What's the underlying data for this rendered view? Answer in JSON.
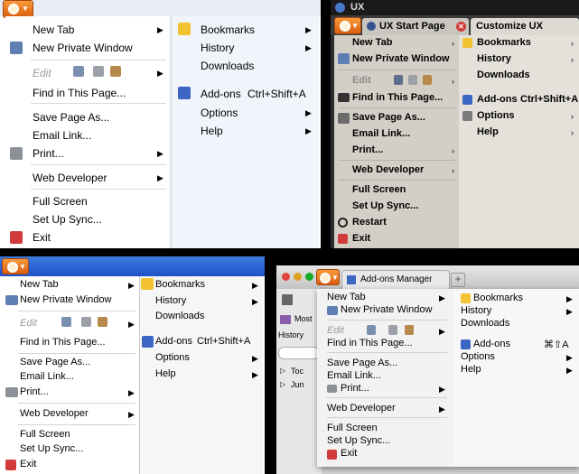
{
  "win7": {
    "left": [
      {
        "label": "New Tab",
        "arrow": true
      },
      {
        "label": "New Private Window",
        "icon": "private-window-icon"
      },
      {
        "label": "Edit",
        "arrow": true,
        "disabled": true
      },
      {
        "label": "Find in This Page..."
      },
      {
        "label": "Save Page As..."
      },
      {
        "label": "Email Link..."
      },
      {
        "label": "Print...",
        "arrow": true,
        "icon": "printer-icon"
      },
      {
        "label": "Web Developer",
        "arrow": true
      },
      {
        "label": "Full Screen"
      },
      {
        "label": "Set Up Sync..."
      },
      {
        "label": "Exit",
        "icon": "exit-icon"
      }
    ],
    "right": [
      {
        "label": "Bookmarks",
        "arrow": true,
        "icon": "star-icon"
      },
      {
        "label": "History",
        "arrow": true
      },
      {
        "label": "Downloads"
      },
      {
        "label": "Add-ons",
        "shortcut": "Ctrl+Shift+A",
        "icon": "puzzle-icon"
      },
      {
        "label": "Options",
        "arrow": true
      },
      {
        "label": "Help",
        "arrow": true
      }
    ]
  },
  "linux": {
    "window_title": "UX",
    "tabs": [
      "UX Start Page",
      "Customize UX"
    ],
    "left": [
      {
        "label": "New Tab"
      },
      {
        "label": "New Private Window"
      },
      {
        "label": "Edit"
      },
      {
        "label": "Find in This Page..."
      },
      {
        "label": "Save Page As..."
      },
      {
        "label": "Email Link..."
      },
      {
        "label": "Print..."
      },
      {
        "label": "Web Developer"
      },
      {
        "label": "Full Screen"
      },
      {
        "label": "Set Up Sync..."
      },
      {
        "label": "Restart"
      },
      {
        "label": "Exit"
      }
    ],
    "right": [
      {
        "label": "Bookmarks"
      },
      {
        "label": "History"
      },
      {
        "label": "Downloads"
      },
      {
        "label": "Add-ons",
        "shortcut": "Ctrl+Shift+A"
      },
      {
        "label": "Options"
      },
      {
        "label": "Help"
      }
    ]
  },
  "winxp": {
    "left": [
      {
        "label": "New Tab"
      },
      {
        "label": "New Private Window"
      },
      {
        "label": "Edit"
      },
      {
        "label": "Find in This Page..."
      },
      {
        "label": "Save Page As..."
      },
      {
        "label": "Email Link..."
      },
      {
        "label": "Print..."
      },
      {
        "label": "Web Developer"
      },
      {
        "label": "Full Screen"
      },
      {
        "label": "Set Up Sync..."
      },
      {
        "label": "Exit"
      }
    ],
    "right": [
      {
        "label": "Bookmarks"
      },
      {
        "label": "History"
      },
      {
        "label": "Downloads"
      },
      {
        "label": "Add-ons",
        "shortcut": "Ctrl+Shift+A"
      },
      {
        "label": "Options"
      },
      {
        "label": "Help"
      }
    ]
  },
  "mac": {
    "tab_title": "Add-ons Manager",
    "sidebar": {
      "most_label": "Most",
      "history_label": "History",
      "today_label": "Toc",
      "june_label": "Jun"
    },
    "left": [
      {
        "label": "New Tab"
      },
      {
        "label": "New Private Window"
      },
      {
        "label": "Edit"
      },
      {
        "label": "Find in This Page..."
      },
      {
        "label": "Save Page As..."
      },
      {
        "label": "Email Link..."
      },
      {
        "label": "Print..."
      },
      {
        "label": "Web Developer"
      },
      {
        "label": "Full Screen"
      },
      {
        "label": "Set Up Sync..."
      },
      {
        "label": "Exit"
      }
    ],
    "right": [
      {
        "label": "Bookmarks"
      },
      {
        "label": "History"
      },
      {
        "label": "Downloads"
      },
      {
        "label": "Add-ons",
        "shortcut": "⌘⇧A"
      },
      {
        "label": "Options"
      },
      {
        "label": "Help"
      }
    ]
  }
}
